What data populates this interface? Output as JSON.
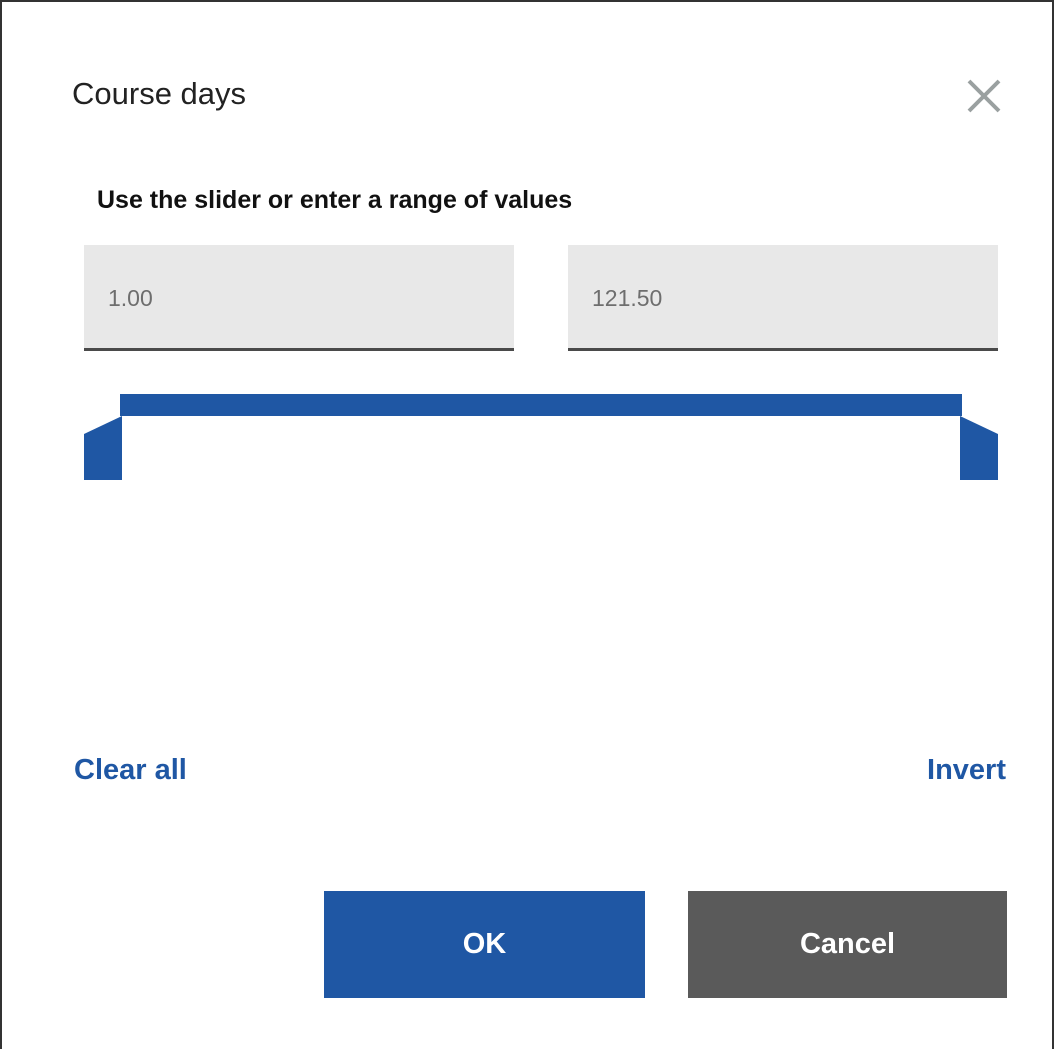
{
  "dialog": {
    "title": "Course days",
    "subtitle": "Use the slider or enter a range of values",
    "close_icon": "close-icon"
  },
  "range": {
    "min_value": "1.00",
    "max_value": "121.50",
    "selected_fraction": [
      0,
      1
    ],
    "accent_color": "#1f57a4"
  },
  "links": {
    "clear_all": "Clear all",
    "invert": "Invert"
  },
  "buttons": {
    "ok": "OK",
    "cancel": "Cancel",
    "ok_color": "#1f57a4",
    "cancel_color": "#5a5a5a"
  }
}
